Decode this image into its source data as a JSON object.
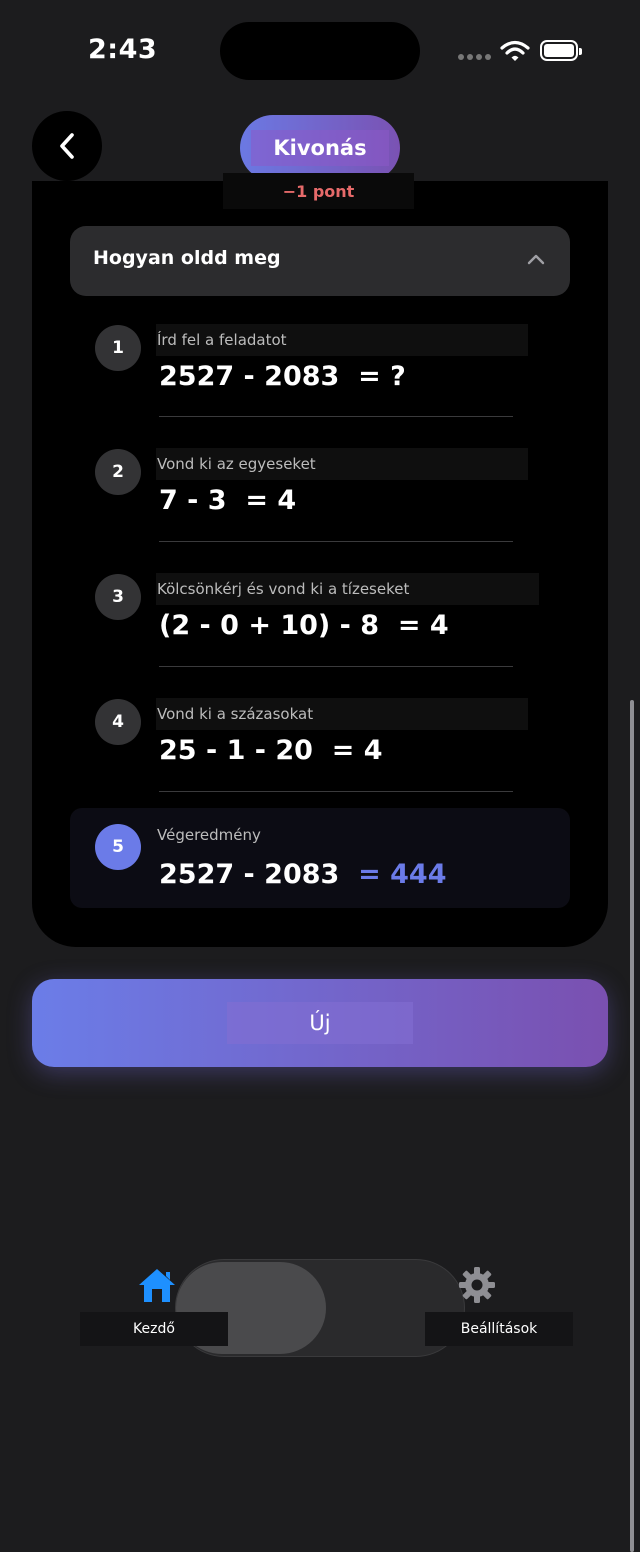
{
  "status_bar": {
    "time": "2:43"
  },
  "header": {
    "title": "Kivonás",
    "points": "−1 pont"
  },
  "howto": {
    "title": "Hogyan oldd meg"
  },
  "steps": [
    {
      "number": "1",
      "caption": "Írd fel a feladatot",
      "expression": "2527 - 2083",
      "result": "= ?"
    },
    {
      "number": "2",
      "caption": "Vond ki az egyeseket",
      "expression": "7 - 3",
      "result": "= 4"
    },
    {
      "number": "3",
      "caption": "Kölcsönkérj és vond ki a tízeseket",
      "expression": "(2 - 0 + 10) - 8",
      "result": "= 4"
    },
    {
      "number": "4",
      "caption": "Vond ki a százasokat",
      "expression": "25 - 1 - 20",
      "result": "= 4"
    },
    {
      "number": "5",
      "caption": "Végeredmény",
      "expression": "2527 - 2083",
      "result": "= 444"
    }
  ],
  "new_button": {
    "label": "Új"
  },
  "tabbar": {
    "home_label": "Kezdő",
    "settings_label": "Beállítások"
  },
  "colors": {
    "accent": "#6b7be8",
    "points": "#e66a6a",
    "tab_active": "#1e90ff"
  }
}
